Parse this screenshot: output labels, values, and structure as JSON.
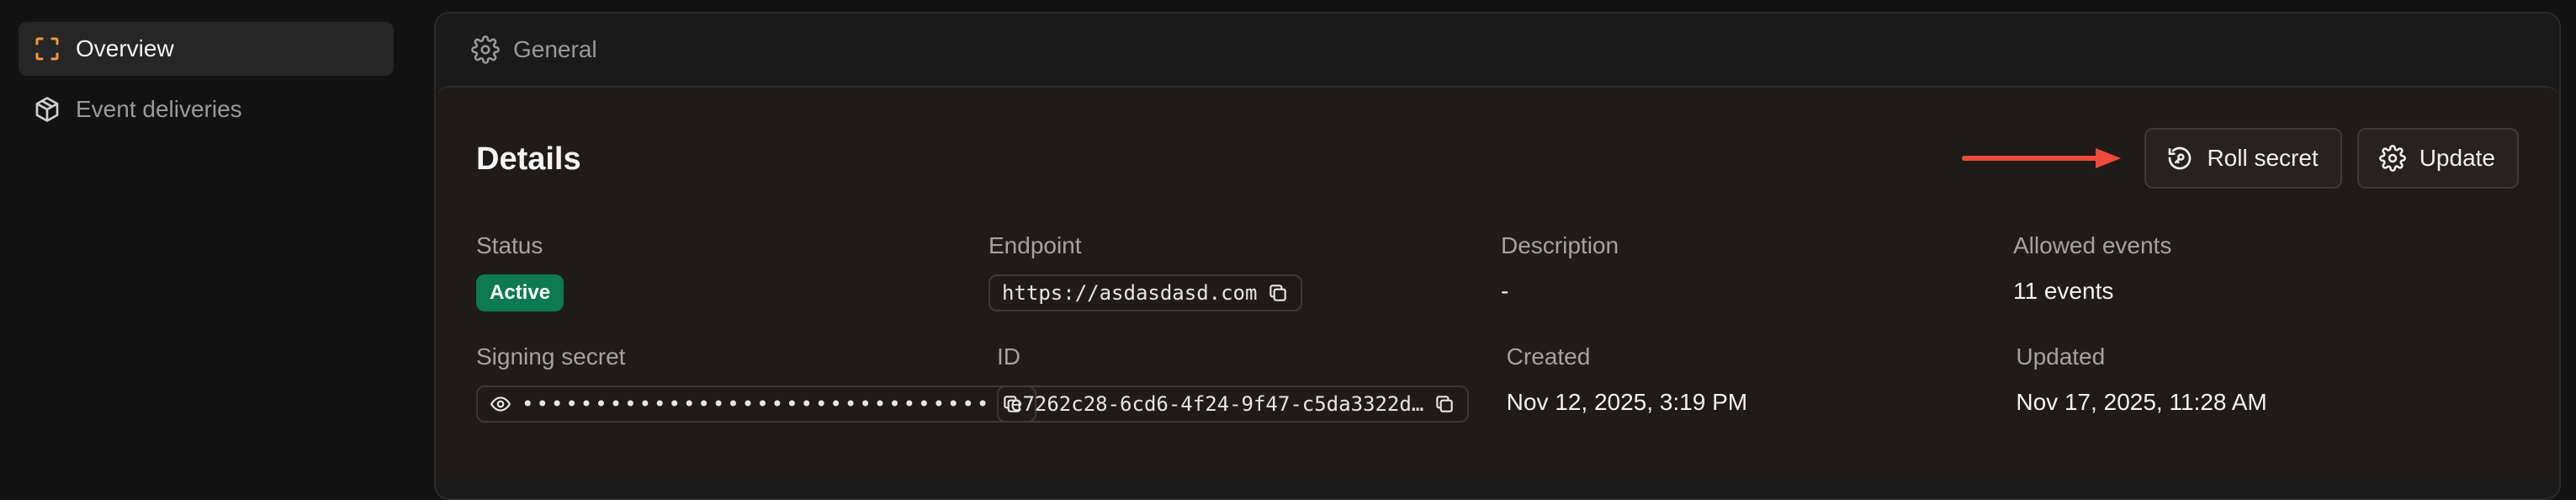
{
  "sidebar": {
    "items": [
      {
        "label": "Overview",
        "icon": "scan-icon",
        "active": true
      },
      {
        "label": "Event deliveries",
        "icon": "box-icon",
        "active": false
      }
    ]
  },
  "panel": {
    "header": {
      "label": "General",
      "icon": "gear-icon"
    }
  },
  "details": {
    "title": "Details",
    "actions": {
      "roll_secret_label": "Roll secret",
      "update_label": "Update"
    },
    "fields": {
      "status_label": "Status",
      "status_value": "Active",
      "endpoint_label": "Endpoint",
      "endpoint_value": "https://asdasdasd.com",
      "description_label": "Description",
      "description_value": "-",
      "allowed_events_label": "Allowed events",
      "allowed_events_value": "11 events",
      "signing_secret_label": "Signing secret",
      "signing_secret_value": "••••••••••••••••••••••••••••••••",
      "id_label": "ID",
      "id_value": "e7262c28-6cd6-4f24-9f47-c5da3322d…",
      "created_label": "Created",
      "created_value": "Nov 12, 2025, 3:19 PM",
      "updated_label": "Updated",
      "updated_value": "Nov 17, 2025, 11:28 AM"
    }
  },
  "colors": {
    "accent_orange": "#f39a34",
    "badge_green": "#0d7a4f",
    "arrow_red": "#ef4a3c"
  }
}
